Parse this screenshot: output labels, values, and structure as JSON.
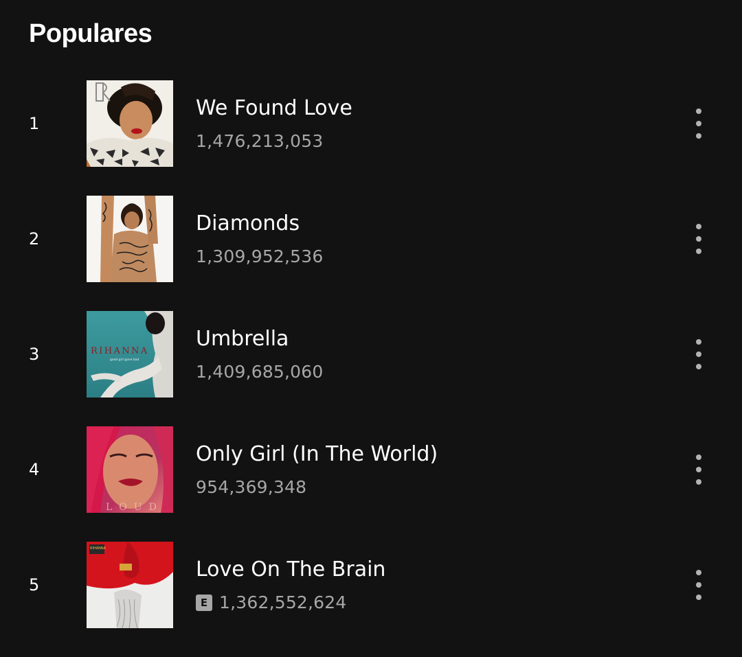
{
  "section": {
    "title": "Populares"
  },
  "tracks": [
    {
      "rank": "1",
      "title": "We Found Love",
      "plays": "1,476,213,053",
      "explicit": false,
      "cover": "album-cover-talk-that-talk"
    },
    {
      "rank": "2",
      "title": "Diamonds",
      "plays": "1,309,952,536",
      "explicit": false,
      "cover": "album-cover-unapologetic"
    },
    {
      "rank": "3",
      "title": "Umbrella",
      "plays": "1,409,685,060",
      "explicit": false,
      "cover": "album-cover-good-girl-gone-bad"
    },
    {
      "rank": "4",
      "title": "Only Girl (In The World)",
      "plays": "954,369,348",
      "explicit": false,
      "cover": "album-cover-loud"
    },
    {
      "rank": "5",
      "title": "Love On The Brain",
      "plays": "1,362,552,624",
      "explicit": true,
      "explicit_label": "E",
      "cover": "album-cover-anti"
    }
  ],
  "colors": {
    "background": "#121212",
    "primary_text": "#ffffff",
    "secondary_text": "#a7a7a7"
  }
}
